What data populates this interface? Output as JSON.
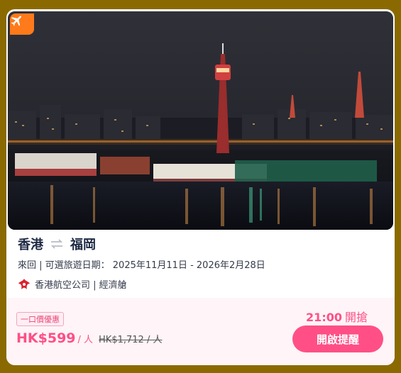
{
  "badge": {
    "icon": "airplane-icon",
    "color": "#ff7a1a"
  },
  "route": {
    "origin": "香港",
    "destination": "福岡",
    "arrow_icon": "swap-arrows-icon"
  },
  "travel": {
    "dates_text": "來回 | 可選旅遊日期： 2025年11月11日 - 2026年2月28日"
  },
  "airline": {
    "text": "香港航空公司 | 經濟艙",
    "logo_icon": "hong-kong-airlines-logo-icon"
  },
  "deal": {
    "tag": "一口價優惠",
    "price": "HK$599",
    "per_person": "/ 人",
    "original_price": "HK$1,712 / 人",
    "open_time": "21:00",
    "open_suffix": "開搶",
    "remind_button": "開啟提醒"
  },
  "colors": {
    "accent": "#ff4f86",
    "background": "#8a6a00"
  }
}
